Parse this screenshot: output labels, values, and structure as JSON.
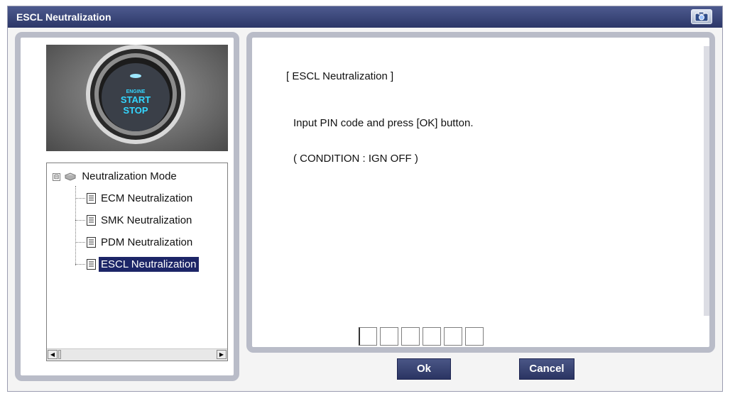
{
  "window": {
    "title": "ESCL Neutralization",
    "camera_icon": "camera-icon",
    "colors": {
      "titlebar": "#2c3768",
      "selection": "#1c2567",
      "panel_border": "#b9bcc8"
    }
  },
  "image": {
    "button_text_line1": "START",
    "button_text_line2": "STOP"
  },
  "tree": {
    "root": {
      "label": "Neutralization Mode",
      "expander": "⊟",
      "icon": "folder-icon"
    },
    "items": [
      {
        "label": "ECM Neutralization",
        "icon": "document-icon"
      },
      {
        "label": "SMK Neutralization",
        "icon": "document-icon"
      },
      {
        "label": "PDM Neutralization",
        "icon": "document-icon"
      },
      {
        "label": "ESCL Neutralization",
        "icon": "document-icon",
        "selected": true
      }
    ],
    "scroll": {
      "left_arrow": "◀",
      "right_arrow": "▶"
    }
  },
  "message": {
    "heading": "[ ESCL Neutralization ]",
    "instruction": "Input PIN code and press [OK] button.",
    "condition": "( CONDITION : IGN OFF )"
  },
  "pin": {
    "digits": [
      "",
      "",
      "",
      "",
      "",
      ""
    ]
  },
  "buttons": {
    "ok": "Ok",
    "cancel": "Cancel"
  }
}
